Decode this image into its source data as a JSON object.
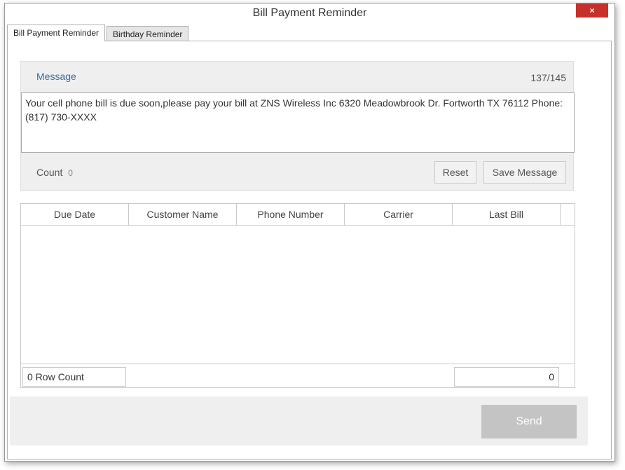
{
  "window": {
    "title": "Bill Payment Reminder",
    "close_glyph": "×"
  },
  "tabs": [
    {
      "label": "Bill Payment Reminder",
      "active": true
    },
    {
      "label": "Birthday Reminder",
      "active": false
    }
  ],
  "message": {
    "label": "Message",
    "counter": "137/145",
    "text": "Your cell phone bill is due soon,please  pay your bill at ZNS Wireless Inc 6320 Meadowbrook Dr.  Fortworth TX 76112 Phone: (817) 730-XXXX",
    "count_label": "Count",
    "count_value": "0",
    "reset_label": "Reset",
    "save_label": "Save Message"
  },
  "grid": {
    "columns": [
      "Due Date",
      "Customer Name",
      "Phone Number",
      "Carrier",
      "Last Bill"
    ],
    "rows": [],
    "row_count_text": "0 Row Count",
    "total_value": "0"
  },
  "actions": {
    "send_label": "Send"
  },
  "colors": {
    "close_button": "#c7302b",
    "send_disabled": "#c4c4c4",
    "message_label": "#3f6ca0"
  }
}
